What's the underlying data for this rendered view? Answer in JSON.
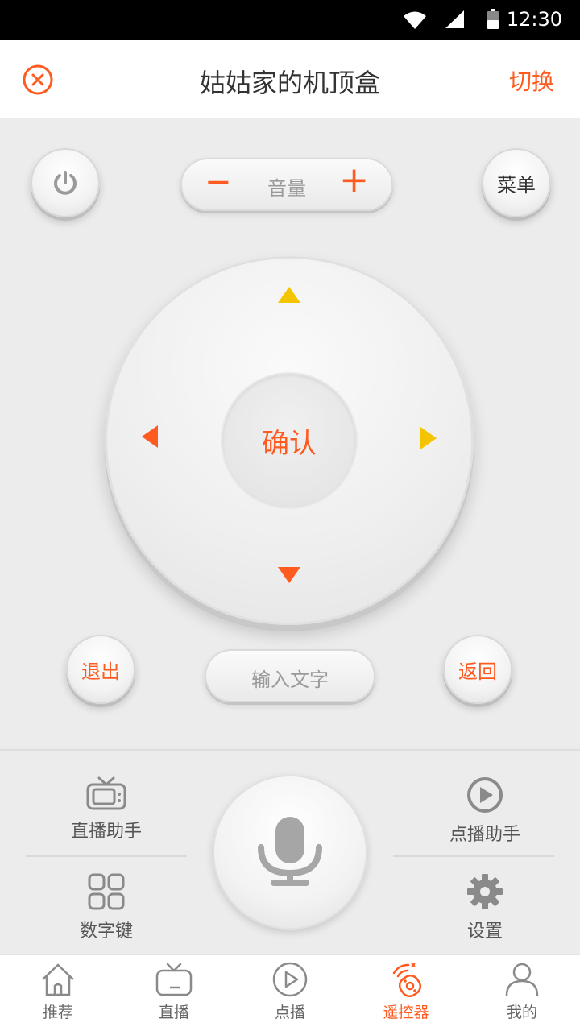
{
  "status_bar": {
    "time": "12:30",
    "icons": [
      "wifi-icon",
      "signal-icon",
      "battery-icon"
    ]
  },
  "header": {
    "title": "姑姑家的机顶盒",
    "switch_label": "切换",
    "close_icon": "close-icon"
  },
  "remote": {
    "power_icon": "power-icon",
    "volume_label": "音量",
    "volume_minus": "−",
    "volume_plus": "+",
    "menu_label": "菜单",
    "ok_label": "确认",
    "exit_label": "退出",
    "input_text_label": "输入文字",
    "back_label": "返回"
  },
  "assistants": {
    "live_assistant": "直播助手",
    "vod_assistant": "点播助手",
    "number_keys": "数字键",
    "settings": "设置",
    "mic_icon": "microphone-icon"
  },
  "tabs": [
    {
      "label": "推荐",
      "icon": "home-icon",
      "active": false
    },
    {
      "label": "直播",
      "icon": "tv-icon",
      "active": false
    },
    {
      "label": "点播",
      "icon": "play-icon",
      "active": false
    },
    {
      "label": "遥控器",
      "icon": "remote-icon",
      "active": true
    },
    {
      "label": "我的",
      "icon": "user-icon",
      "active": false
    }
  ],
  "colors": {
    "accent": "#ff5a1f",
    "arrow_yellow": "#f5c400",
    "text_gray": "#666666"
  }
}
